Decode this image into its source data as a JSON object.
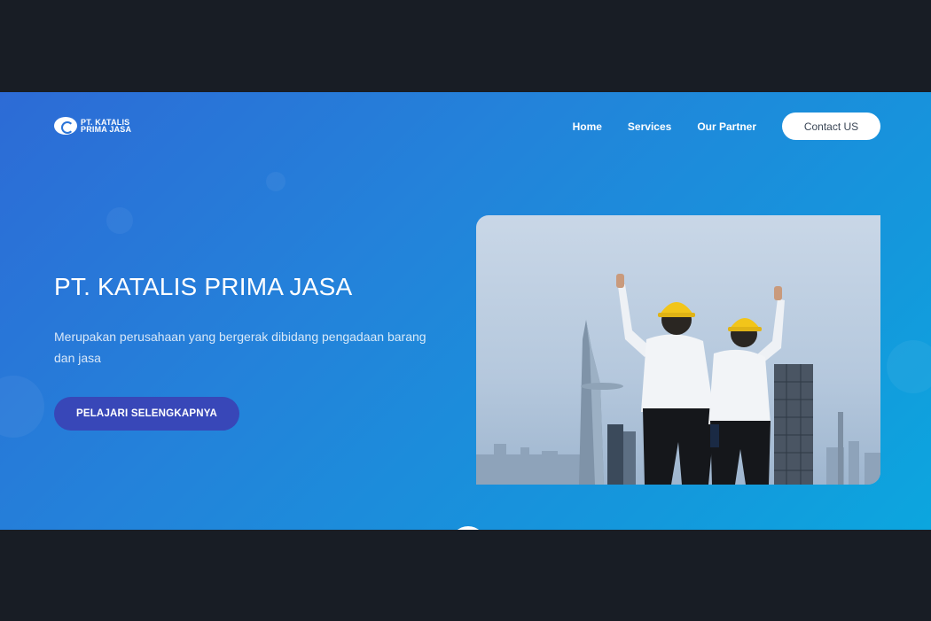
{
  "brand": {
    "line1": "PT. KATALIS",
    "line2": "PRIMA JASA",
    "colors": {
      "hero_start": "#2d6bd6",
      "hero_end": "#0ca6de",
      "cta": "#3847b8",
      "backdrop": "#181d25"
    }
  },
  "nav": {
    "items": [
      {
        "label": "Home"
      },
      {
        "label": "Services"
      },
      {
        "label": "Our Partner"
      }
    ],
    "contact_label": "Contact US"
  },
  "hero": {
    "title": "PT. KATALIS PRIMA JASA",
    "subtitle": "Merupakan perusahaan yang bergerak dibidang pengadaan barang dan jasa",
    "cta_label": "PELAJARI SELENGKAPNYA",
    "image_subject": "two-engineers-hardhats-city-skyline"
  },
  "icons": {
    "logo": "logo-icon",
    "scroll": "scroll-down-icon"
  }
}
